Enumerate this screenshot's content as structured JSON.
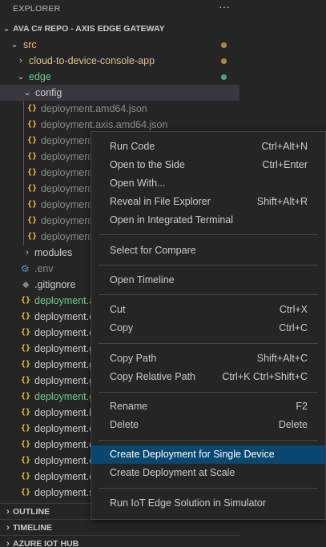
{
  "explorer": {
    "title": "EXPLORER",
    "more_icon": "ellipsis-icon",
    "repo": "AVA C# REPO - AXIS EDGE GATEWAY",
    "src": "src",
    "cloud": "cloud-to-device-console-app",
    "edge": "edge",
    "config": "config",
    "config_files": [
      "deployment.amd64.json",
      "deployment.axis.amd64.json",
      "deployment",
      "deployment",
      "deployment",
      "deployment",
      "deployment",
      "deployment",
      "deployment"
    ],
    "modules": "modules",
    "env": ".env",
    "gitignore": ".gitignore",
    "edge_files": [
      "deployment.a",
      "deployment.c",
      "deployment.c",
      "deployment.g",
      "deployment.g",
      "deployment.g",
      "deployment.g",
      "deployment.h",
      "deployment.c",
      "deployment.c",
      "deployment.c",
      "deployment.c",
      "deployment.s"
    ],
    "decoration_colors": {
      "modified": "#a08a5a",
      "added": "#57a07a",
      "added_text": "#73c991"
    },
    "sections": [
      "OUTLINE",
      "TIMELINE",
      "AZURE IOT HUB"
    ]
  },
  "context_menu": {
    "groups": [
      [
        {
          "label": "Run Code",
          "key": "Ctrl+Alt+N"
        },
        {
          "label": "Open to the Side",
          "key": "Ctrl+Enter"
        },
        {
          "label": "Open With...",
          "key": ""
        },
        {
          "label": "Reveal in File Explorer",
          "key": "Shift+Alt+R"
        },
        {
          "label": "Open in Integrated Terminal",
          "key": ""
        }
      ],
      [
        {
          "label": "Select for Compare",
          "key": ""
        }
      ],
      [
        {
          "label": "Open Timeline",
          "key": ""
        }
      ],
      [
        {
          "label": "Cut",
          "key": "Ctrl+X"
        },
        {
          "label": "Copy",
          "key": "Ctrl+C"
        }
      ],
      [
        {
          "label": "Copy Path",
          "key": "Shift+Alt+C"
        },
        {
          "label": "Copy Relative Path",
          "key": "Ctrl+K Ctrl+Shift+C"
        }
      ],
      [
        {
          "label": "Rename",
          "key": "F2"
        },
        {
          "label": "Delete",
          "key": "Delete"
        }
      ],
      [
        {
          "label": "Create Deployment for Single Device",
          "key": ""
        },
        {
          "label": "Create Deployment at Scale",
          "key": ""
        }
      ],
      [
        {
          "label": "Run IoT Edge Solution in Simulator",
          "key": ""
        }
      ]
    ],
    "highlighted": "Create Deployment for Single Device",
    "highlight_color": "#094771"
  }
}
